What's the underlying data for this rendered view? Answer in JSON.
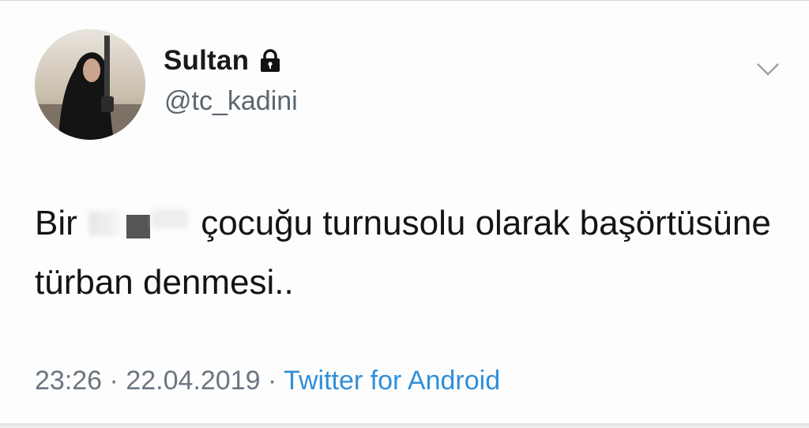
{
  "user": {
    "display_name": "Sultan",
    "handle": "@tc_kadini",
    "protected_icon": "lock-icon",
    "avatar_icon": "profile-photo"
  },
  "header": {
    "menu_icon": "chevron-down-icon"
  },
  "tweet": {
    "text_before_redaction": "Bir ",
    "text_after_redaction": " çocuğu turnusolu olarak başörtüsüne türban denmesi.."
  },
  "meta": {
    "time": "23:26",
    "separator": " · ",
    "date": "22.04.2019",
    "source": "Twitter for Android"
  },
  "colors": {
    "link": "#2f8fd8",
    "secondary_text": "#6b7680",
    "primary_text": "#141414"
  }
}
